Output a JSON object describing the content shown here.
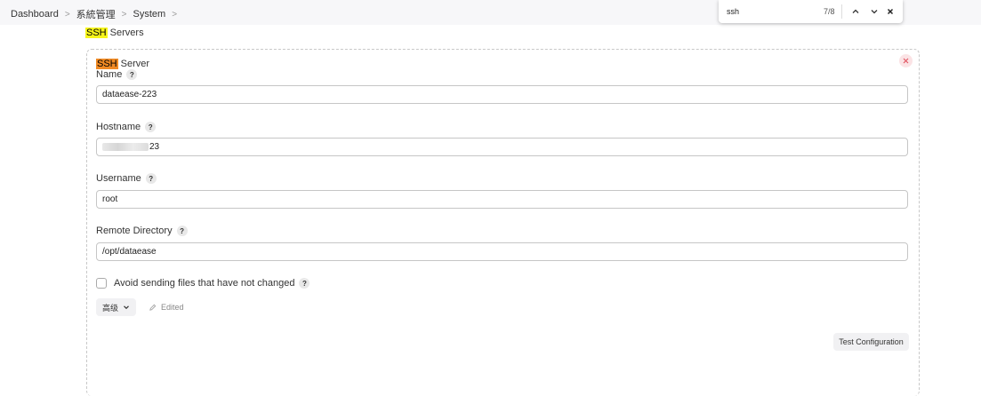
{
  "breadcrumb": {
    "items": [
      "Dashboard",
      "系統管理",
      "System"
    ],
    "separator": ">"
  },
  "find_bar": {
    "query": "ssh",
    "match_count": "7/8",
    "icons": [
      "chevron-up-icon",
      "chevron-down-icon",
      "close-icon"
    ]
  },
  "section": {
    "title_highlight": "SSH",
    "title_rest": " Servers"
  },
  "server": {
    "title_highlight": "SSH",
    "title_rest": " Server",
    "fields": {
      "name": {
        "label": "Name",
        "value": "dataease-223"
      },
      "hostname": {
        "label": "Hostname",
        "value": "23"
      },
      "username": {
        "label": "Username",
        "value": "root"
      },
      "remote_directory": {
        "label": "Remote Directory",
        "value": "/opt/dataease"
      }
    },
    "avoid_sending": {
      "label": "Avoid sending files that have not changed",
      "checked": false
    },
    "advanced_label": "高级",
    "edited_label": "Edited",
    "test_button": "Test Configuration",
    "help_glyph": "?"
  },
  "colors": {
    "highlight": "#f6f51a",
    "highlight_active": "#f08a24",
    "close_bg": "#fbe3e5",
    "close_fg": "#e0525f"
  }
}
